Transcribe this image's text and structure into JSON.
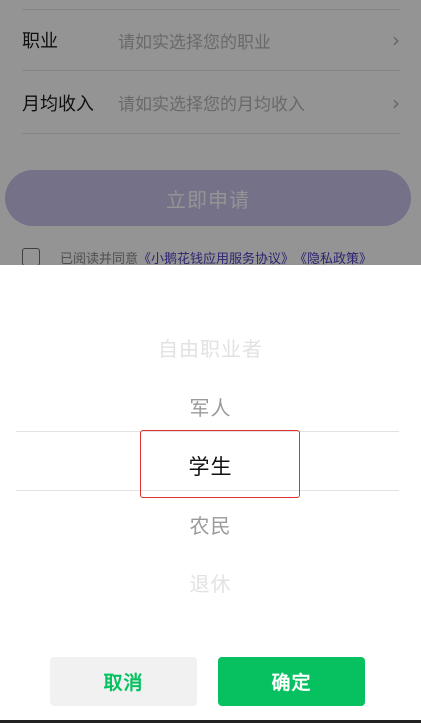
{
  "form": {
    "rows": [
      {
        "label": "职业",
        "placeholder": "请如实选择您的职业",
        "chevron": "›"
      },
      {
        "label": "月均收入",
        "placeholder": "请如实选择您的月均收入",
        "chevron": "›"
      }
    ],
    "apply_button": "立即申请",
    "agreement": {
      "prefix": "已阅读并同意",
      "link1": "《小鹅花钱应用服务协议》",
      "link2": "《隐私政策》"
    }
  },
  "picker": {
    "options": [
      "自由职业者",
      "军人",
      "学生",
      "农民",
      "退休"
    ],
    "selected": "学生",
    "cancel_label": "取消",
    "confirm_label": "确定"
  },
  "colors": {
    "accent_green": "#07c160",
    "apply_button_bg": "#c9c3ea",
    "link": "#4d3fc4",
    "highlight_border": "#e0302f"
  }
}
